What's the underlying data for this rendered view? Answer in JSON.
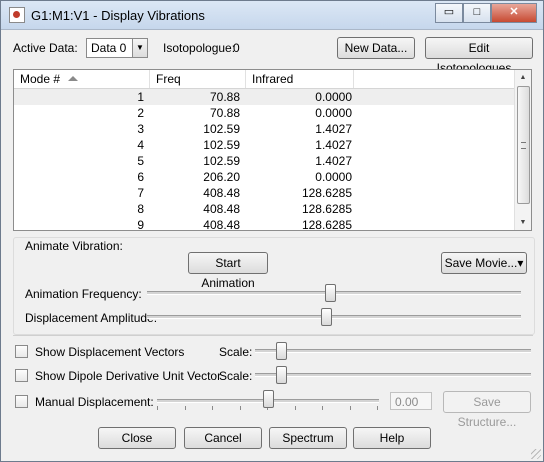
{
  "window": {
    "title": "G1:M1:V1 - Display Vibrations",
    "controls": {
      "minimize": "▭",
      "maximize": "□",
      "close": "✕"
    },
    "icon": "gaussview-icon"
  },
  "toolbar": {
    "active_data_label": "Active Data:",
    "active_data_value": "Data 0",
    "isotopologue_label": "Isotopologue:",
    "isotopologue_value": "0",
    "new_data_button": "New Data...",
    "edit_isotopologues_button": "Edit Isotopologues..."
  },
  "table": {
    "columns": [
      "Mode #",
      "Freq",
      "Infrared"
    ],
    "rows": [
      [
        "1",
        "70.88",
        "0.0000"
      ],
      [
        "2",
        "70.88",
        "0.0000"
      ],
      [
        "3",
        "102.59",
        "1.4027"
      ],
      [
        "4",
        "102.59",
        "1.4027"
      ],
      [
        "5",
        "102.59",
        "1.4027"
      ],
      [
        "6",
        "206.20",
        "0.0000"
      ],
      [
        "7",
        "408.48",
        "128.6285"
      ],
      [
        "8",
        "408.48",
        "128.6285"
      ],
      [
        "9",
        "408.48",
        "128.6285"
      ]
    ],
    "scroll_position": 0.0
  },
  "animate": {
    "group_label": "Animate Vibration:",
    "start_button": "Start Animation",
    "save_movie_button": "Save Movie...",
    "frequency_label": "Animation Frequency:",
    "frequency_level": 0.49,
    "amplitude_label": "Displacement Amplitude:",
    "amplitude_level": 0.48
  },
  "options": {
    "displacement_vectors_label": "Show Displacement Vectors",
    "displacement_vectors_checked": false,
    "dipole_vector_label": "Show Dipole Derivative Unit Vector",
    "dipole_vector_checked": false,
    "scale_label": "Scale:",
    "scale1_level": 0.08,
    "scale2_level": 0.08,
    "manual_displacement_label": "Manual Displacement:",
    "manual_displacement_checked": false,
    "manual_displacement_level": 0.5,
    "manual_displacement_value": "0.00",
    "save_structure_button": "Save Structure..."
  },
  "footer": {
    "close_button": "Close",
    "cancel_button": "Cancel",
    "spectrum_button": "Spectrum",
    "help_button": "Help"
  }
}
